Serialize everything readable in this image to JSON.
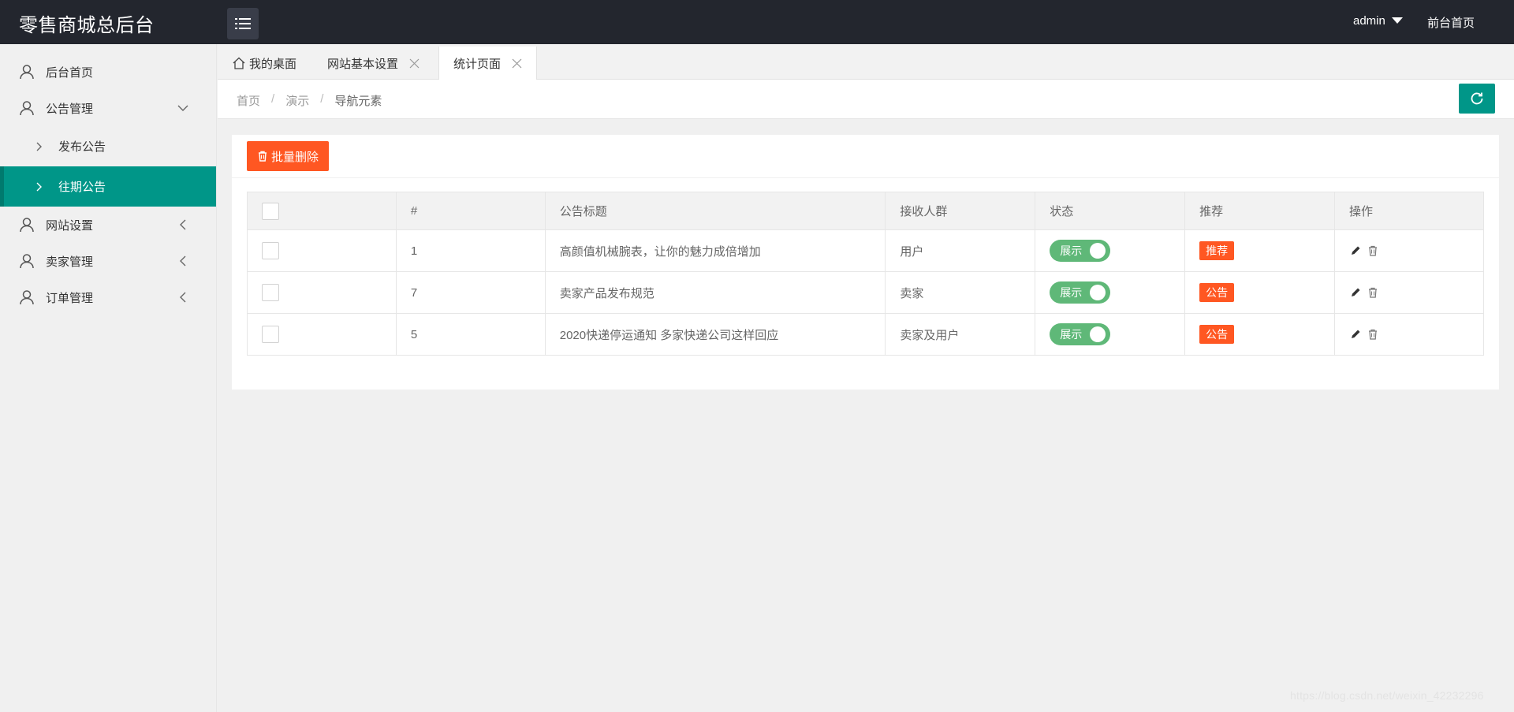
{
  "header": {
    "title": "零售商城总后台",
    "user": "admin",
    "front_link": "前台首页"
  },
  "sidebar": {
    "items": [
      {
        "label": "后台首页"
      },
      {
        "label": "公告管理",
        "sub": [
          {
            "label": "发布公告"
          },
          {
            "label": "往期公告"
          }
        ]
      },
      {
        "label": "网站设置"
      },
      {
        "label": "卖家管理"
      },
      {
        "label": "订单管理"
      }
    ]
  },
  "tabs": [
    {
      "label": "我的桌面"
    },
    {
      "label": "网站基本设置"
    },
    {
      "label": "统计页面"
    }
  ],
  "breadcrumb": [
    "首页",
    "演示",
    "导航元素"
  ],
  "breadcrumb_sep": "/",
  "toolbar": {
    "batch_delete": "批量删除"
  },
  "table": {
    "headers": [
      "",
      "#",
      "公告标题",
      "接收人群",
      "状态",
      "推荐",
      "操作"
    ],
    "rows": [
      {
        "id": "1",
        "title": "高颜值机械腕表，让你的魅力成倍增加",
        "audience": "用户",
        "status": "展示",
        "tag": "推荐"
      },
      {
        "id": "7",
        "title": "卖家产品发布规范",
        "audience": "卖家",
        "status": "展示",
        "tag": "公告"
      },
      {
        "id": "5",
        "title": "2020快递停运通知 多家快递公司这样回应",
        "audience": "卖家及用户",
        "status": "展示",
        "tag": "公告"
      }
    ]
  },
  "watermark": "https://blog.csdn.net/weixin_42232296",
  "colors": {
    "header_bg": "#23262e",
    "accent": "#009688",
    "danger": "#ff5722",
    "switch_on": "#5fb878"
  }
}
